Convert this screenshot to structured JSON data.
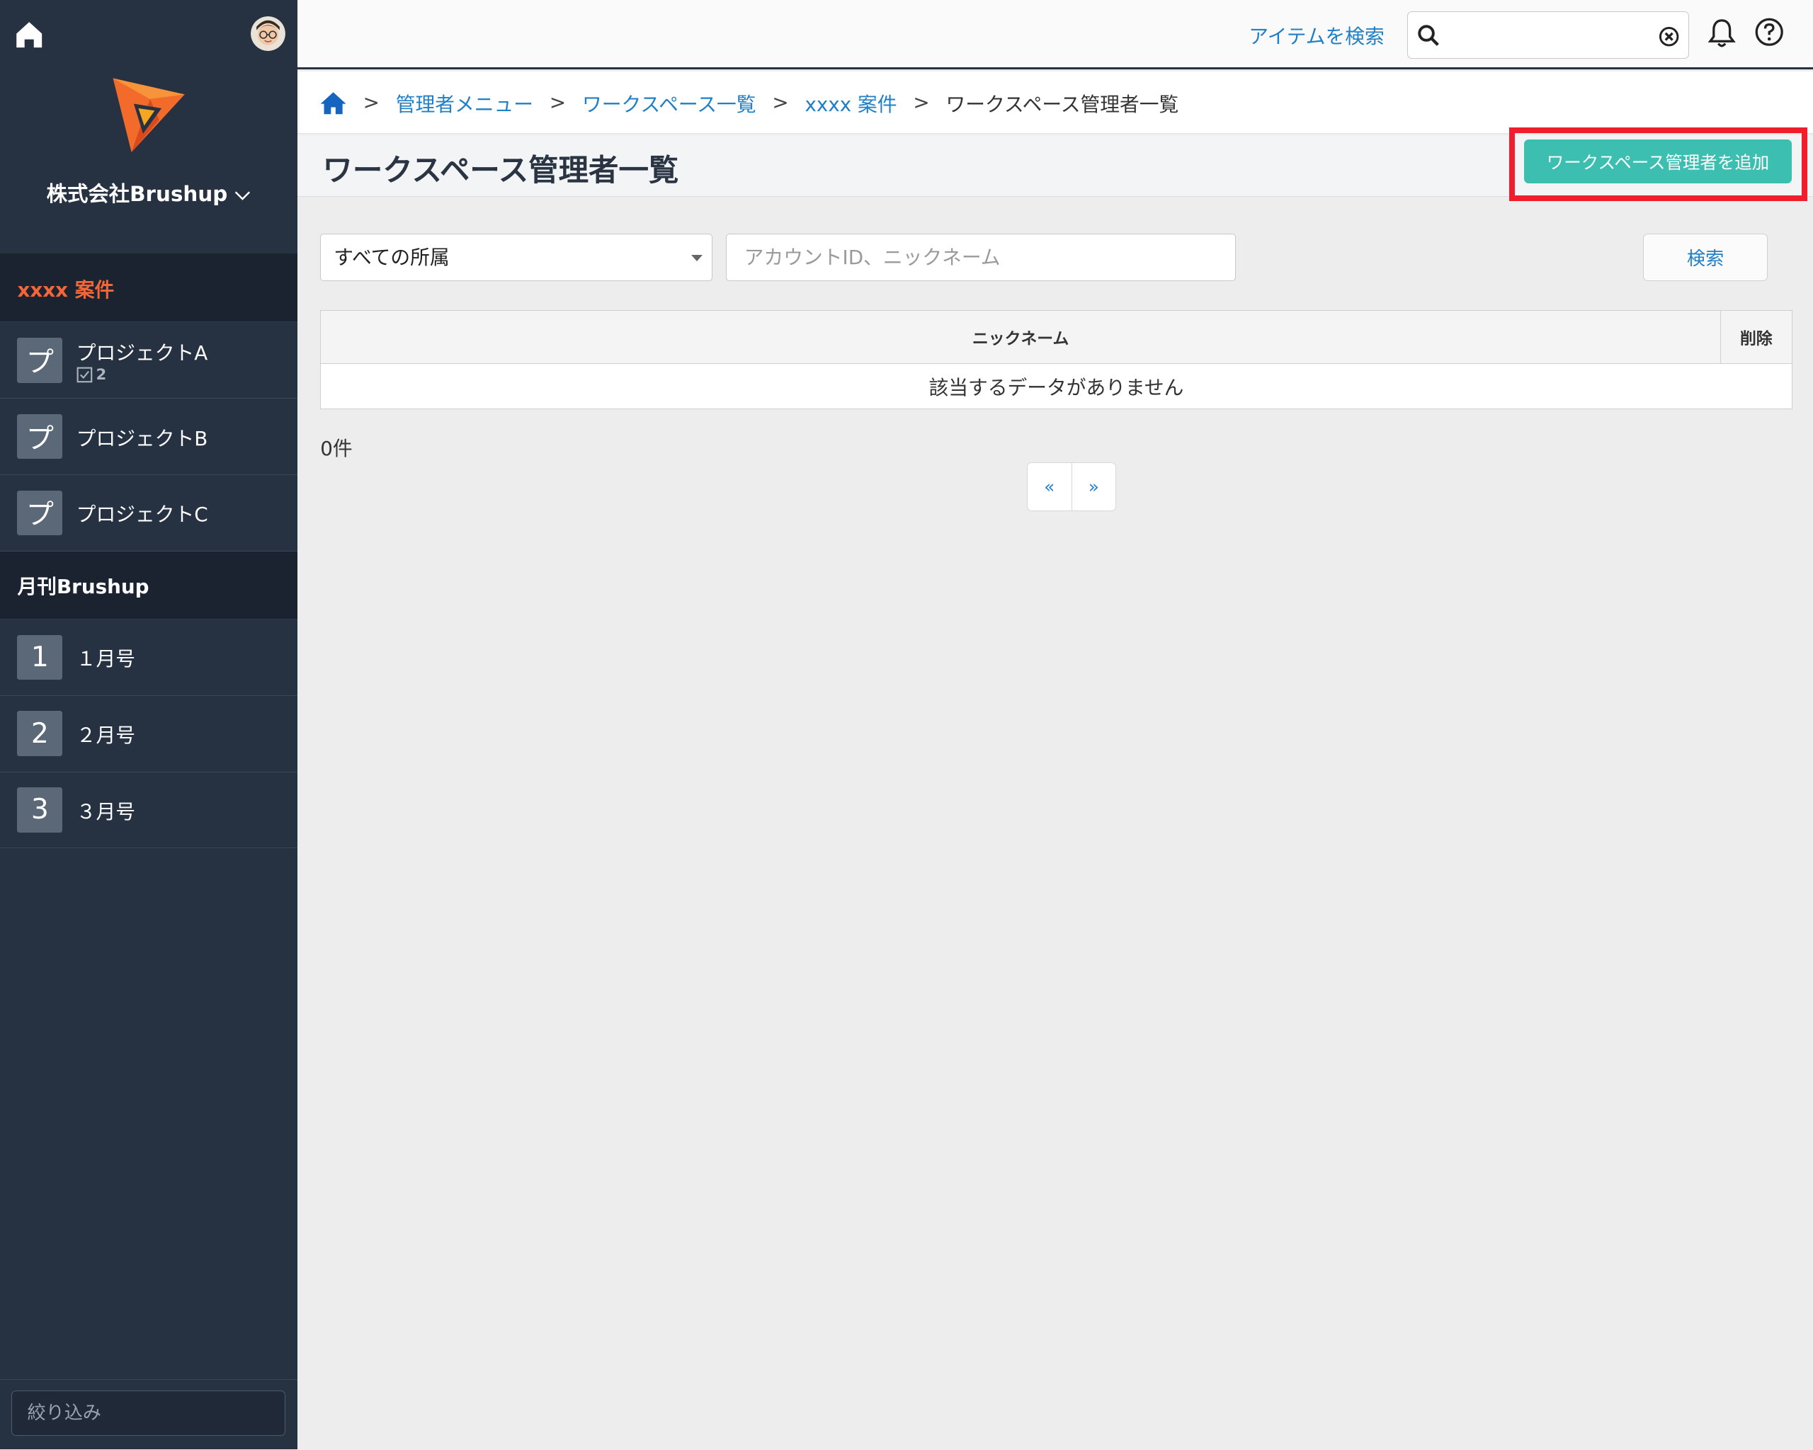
{
  "colors": {
    "sidebar_bg": "#263242",
    "accent_link": "#1f7fc7",
    "add_button": "#3cbfb0",
    "highlight_box": "#f01e2c",
    "section_orange": "#f2663a"
  },
  "sidebar": {
    "home_icon": "home-icon",
    "avatar_icon": "user-avatar",
    "company": "株式会社Brushup",
    "company_icon": "chevron-down-icon",
    "groups": [
      {
        "title": "xxxx 案件",
        "items": [
          {
            "badge": "プ",
            "label": "プロジェクトA",
            "sub_icon": "task-check-icon",
            "sub_count": "2"
          },
          {
            "badge": "プ",
            "label": "プロジェクトB"
          },
          {
            "badge": "プ",
            "label": "プロジェクトC"
          }
        ]
      },
      {
        "title": "月刊Brushup",
        "items": [
          {
            "badge": "1",
            "label": "１月号"
          },
          {
            "badge": "2",
            "label": "２月号"
          },
          {
            "badge": "3",
            "label": "３月号"
          }
        ]
      }
    ],
    "filter_placeholder": "絞り込み"
  },
  "topbar": {
    "search_link": "アイテムを検索",
    "search_icon": "search-icon",
    "clear_icon": "clear-icon",
    "bell_icon": "bell-icon",
    "help_icon": "help-icon"
  },
  "breadcrumb": {
    "home_icon": "home-icon",
    "sep": ">",
    "links": [
      "管理者メニュー",
      "ワークスペース一覧",
      "xxxx 案件"
    ],
    "current": "ワークスペース管理者一覧"
  },
  "page": {
    "title": "ワークスペース管理者一覧",
    "add_button": "ワークスペース管理者を追加"
  },
  "filters": {
    "affiliation_selected": "すべての所属",
    "keyword_placeholder": "アカウントID、ニックネーム",
    "search_button": "検索"
  },
  "table": {
    "columns": [
      "ニックネーム",
      "削除"
    ],
    "empty_message": "該当するデータがありません"
  },
  "count_label": "0件",
  "pager": {
    "prev": "«",
    "next": "»"
  }
}
